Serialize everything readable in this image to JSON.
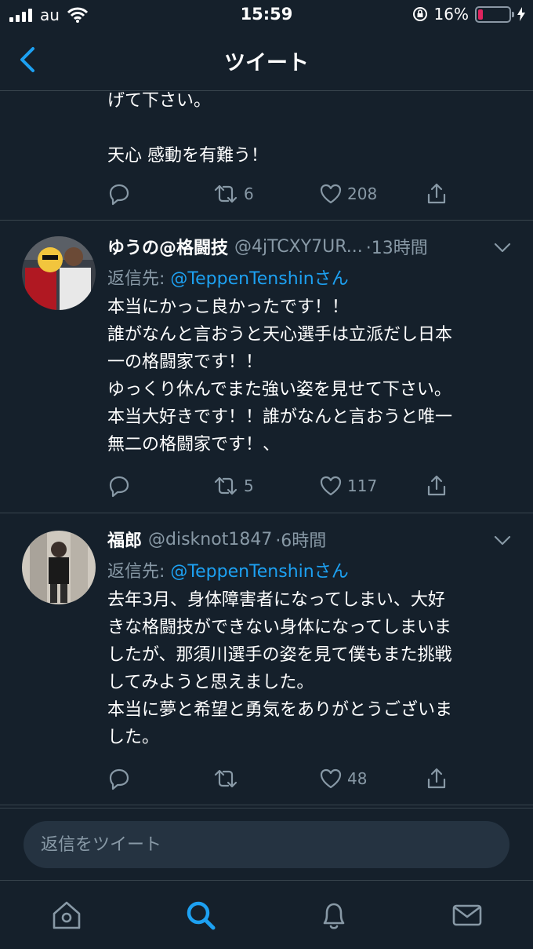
{
  "status_bar": {
    "carrier": "au",
    "time": "15:59",
    "battery_percent": "16%",
    "battery_level": 0.16,
    "battery_color": "#e0245e"
  },
  "nav": {
    "title": "ツイート",
    "back_icon": "chevron-left-icon"
  },
  "previous_tweet": {
    "text_tail": "げて下さい。\n\n天心 感動を有難う！",
    "retweets": "6",
    "likes": "208"
  },
  "tweets": [
    {
      "name": "ゆうの@格闘技",
      "handle": "@4jTCXY7UR...",
      "time": "·13時間",
      "reply_prefix": "返信先: ",
      "reply_mention": "@TeppenTenshinさん",
      "text": "本当にかっこ良かったです！！\n誰がなんと言おうと天心選手は立派だし日本\n一の格闘家です！！\nゆっくり休んでまた強い姿を見せて下さい。\n本当大好きです！！誰がなんと言おうと唯一\n無二の格闘家です！、",
      "retweets": "5",
      "likes": "117"
    },
    {
      "name": "福郎",
      "handle": "@disknot1847",
      "time": "·6時間",
      "reply_prefix": "返信先: ",
      "reply_mention": "@TeppenTenshinさん",
      "text": "去年3月、身体障害者になってしまい、大好\nきな格闘技ができない身体になってしまいま\nしたが、那須川選手の姿を見て僕もまた挑戦\nしてみようと思えました。\n本当に夢と希望と勇気をありがとうございま\nした。",
      "retweets": "",
      "likes": "48"
    }
  ],
  "composer": {
    "placeholder": "返信をツイート"
  },
  "tabbar": {
    "items": [
      "home-icon",
      "search-icon",
      "notifications-icon",
      "messages-icon"
    ],
    "active": "search-icon",
    "accent": "#1da1f2"
  }
}
